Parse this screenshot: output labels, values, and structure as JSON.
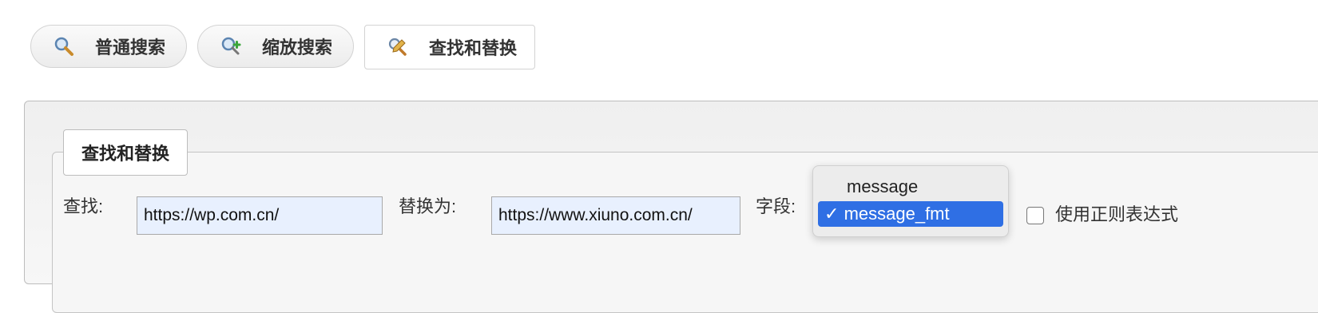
{
  "tabs": [
    {
      "label": "普通搜索",
      "icon": "magnifier-icon"
    },
    {
      "label": "缩放搜索",
      "icon": "zoom-search-icon"
    },
    {
      "label": "查找和替换",
      "icon": "find-replace-icon"
    }
  ],
  "section": {
    "legend": "查找和替换",
    "find_label": "查找:",
    "find_value": "https://wp.com.cn/",
    "replace_label": "替换为:",
    "replace_value": "https://www.xiuno.com.cn/",
    "field_label": "字段:",
    "field_options": [
      "message",
      "message_fmt"
    ],
    "field_selected": "message_fmt",
    "checkmark": "✓",
    "regex_label": "使用正则表达式"
  },
  "colors": {
    "selected_option": "#2f6fe4",
    "input_autofill_bg": "#e8f0fe"
  }
}
